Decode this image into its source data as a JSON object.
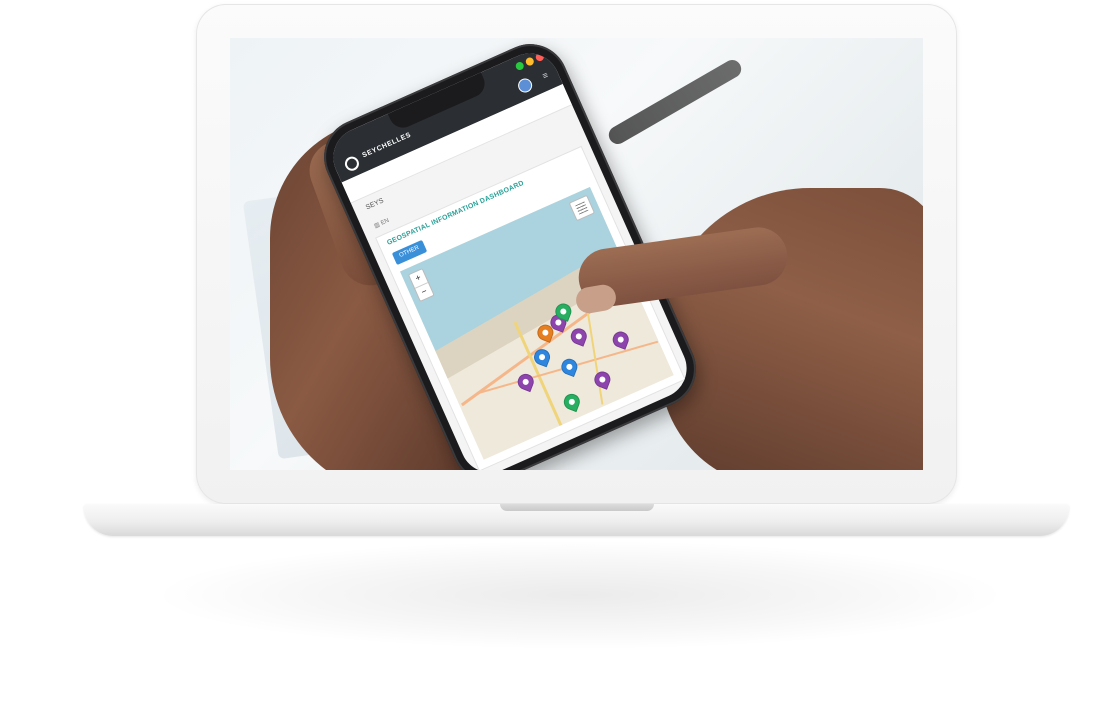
{
  "phone_app": {
    "brand": "SEYCHELLES",
    "page_label": "SEYS",
    "section_label": "▥ EN",
    "panel_title": "GEOSPATIAL INFORMATION DASHBOARD",
    "filter_button": "OTHER",
    "zoom_in": "+",
    "zoom_out": "−"
  },
  "icons": {
    "app_logo": "globe-logo-icon",
    "avatar": "user-avatar-icon",
    "menu": "hamburger-menu-icon",
    "layers": "map-layers-icon",
    "marker": "map-marker-icon"
  },
  "colors": {
    "header": "#2b2f33",
    "accent_teal": "#2aa198",
    "button_blue": "#3a8fd9",
    "marker_purple": "#8e44ad",
    "marker_blue": "#2e86de",
    "marker_green": "#27ae60",
    "marker_orange": "#e67e22",
    "dot_green": "#27c93f",
    "dot_yellow": "#ffbd2e",
    "dot_red": "#ff5f56"
  }
}
